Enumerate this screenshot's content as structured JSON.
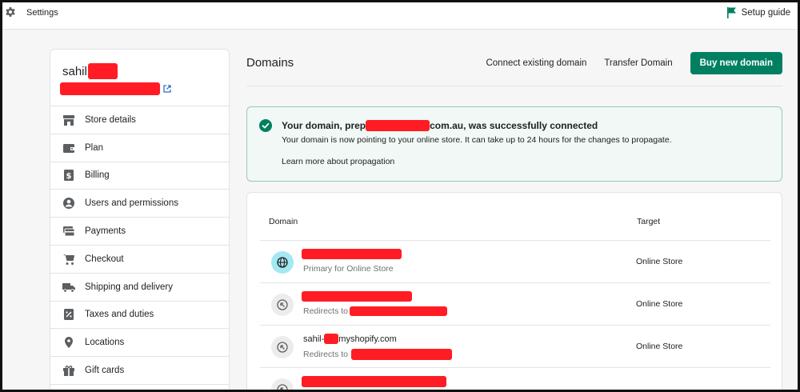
{
  "topbar": {
    "title": "Settings",
    "setup_guide": "Setup guide"
  },
  "store": {
    "name": "sahil"
  },
  "sidebar": {
    "items": [
      {
        "label": "Store details",
        "icon": "store-icon"
      },
      {
        "label": "Plan",
        "icon": "wallet-icon"
      },
      {
        "label": "Billing",
        "icon": "dollar-icon"
      },
      {
        "label": "Users and permissions",
        "icon": "user-icon"
      },
      {
        "label": "Payments",
        "icon": "card-icon"
      },
      {
        "label": "Checkout",
        "icon": "cart-icon"
      },
      {
        "label": "Shipping and delivery",
        "icon": "truck-icon"
      },
      {
        "label": "Taxes and duties",
        "icon": "tax-icon"
      },
      {
        "label": "Locations",
        "icon": "location-icon"
      },
      {
        "label": "Gift cards",
        "icon": "gift-icon"
      }
    ]
  },
  "header": {
    "title": "Domains",
    "connect_label": "Connect existing domain",
    "transfer_label": "Transfer Domain",
    "buy_label": "Buy new domain"
  },
  "banner": {
    "title_prefix": "Your domain, prep",
    "title_suffix": "com.au, was successfully connected",
    "description": "Your domain is now pointing to your online store. It can take up to 24 hours for the changes to propagate.",
    "link": "Learn more about propagation"
  },
  "table": {
    "col_domain": "Domain",
    "col_target": "Target",
    "rows": [
      {
        "subtitle": "Primary for Online Store",
        "target": "Online Store"
      },
      {
        "subtitle": "Redirects to",
        "target": "Online Store"
      },
      {
        "name_prefix": "sahil-",
        "name_suffix": "myshopify.com",
        "subtitle": "Redirects to",
        "target": "Online Store"
      }
    ]
  },
  "colors": {
    "primary": "#008060",
    "success_bg": "#f1f8f5",
    "redaction": "#ff1c24"
  }
}
